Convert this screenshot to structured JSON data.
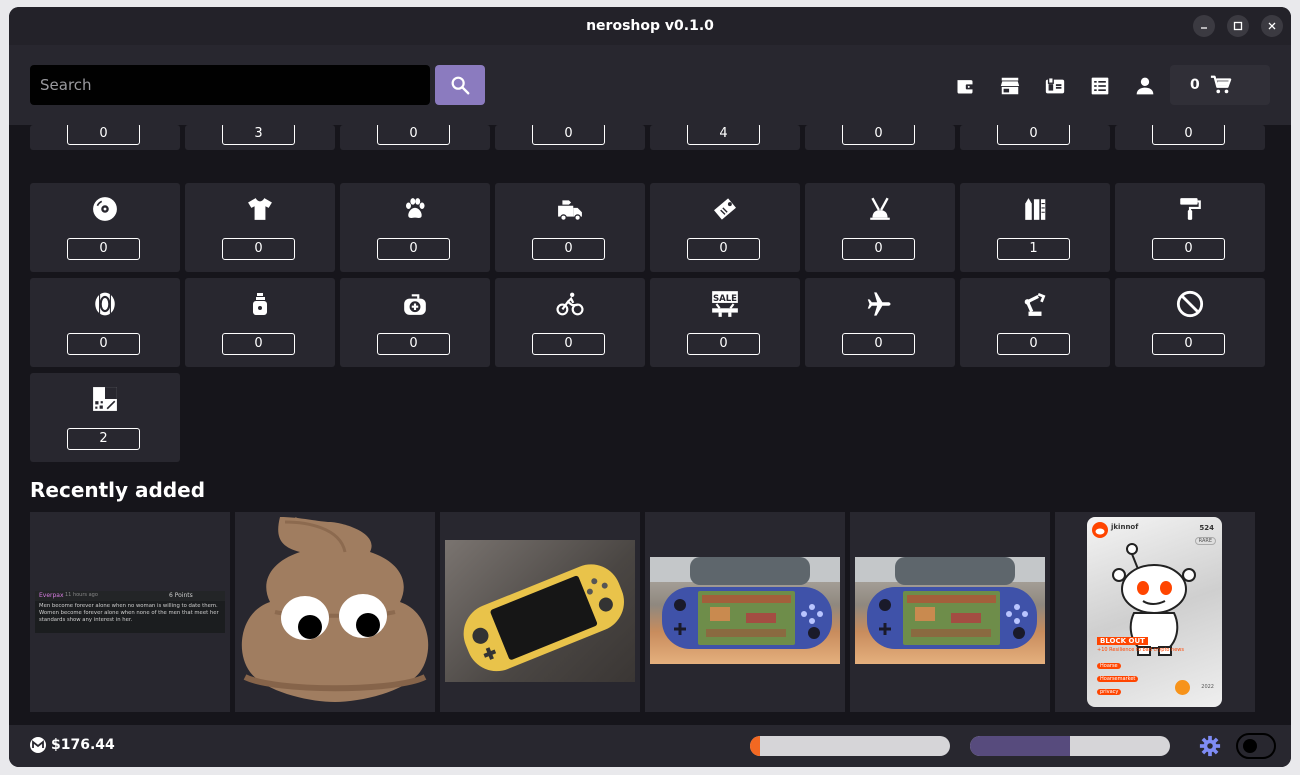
{
  "window": {
    "title": "neroshop v0.1.0",
    "minimize_icon": "minimize-icon",
    "maximize_icon": "maximize-icon",
    "close_icon": "close-icon"
  },
  "header": {
    "search": {
      "placeholder": "Search",
      "value": ""
    },
    "nav_icons": [
      "wallet-icon",
      "store-icon",
      "inventory-icon",
      "orders-icon",
      "account-icon"
    ],
    "cart": {
      "count": "0",
      "icon": "cart-icon"
    }
  },
  "categories": {
    "row0": [
      "0",
      "3",
      "0",
      "0",
      "4",
      "0",
      "0",
      "0"
    ],
    "row1": [
      {
        "icon": "disc-icon",
        "count": "0"
      },
      {
        "icon": "tshirt-icon",
        "count": "0"
      },
      {
        "icon": "paw-icon",
        "count": "0"
      },
      {
        "icon": "truck-icon",
        "count": "0"
      },
      {
        "icon": "tag-icon",
        "count": "0"
      },
      {
        "icon": "desk-lamp-icon",
        "count": "0"
      },
      {
        "icon": "books-icon",
        "count": "1"
      },
      {
        "icon": "paint-roller-icon",
        "count": "0"
      }
    ],
    "row2": [
      {
        "icon": "tire-icon",
        "count": "0"
      },
      {
        "icon": "medicine-bottle-icon",
        "count": "0"
      },
      {
        "icon": "first-aid-kit-icon",
        "count": "0"
      },
      {
        "icon": "bicycle-icon",
        "count": "0"
      },
      {
        "icon": "sale-sign-icon",
        "count": "0"
      },
      {
        "icon": "airplane-icon",
        "count": "0"
      },
      {
        "icon": "robot-arm-icon",
        "count": "0"
      },
      {
        "icon": "prohibited-icon",
        "count": "0"
      }
    ],
    "row3": [
      {
        "icon": "misc-pattern-icon",
        "count": "2"
      }
    ]
  },
  "recent": {
    "title": "Recently added",
    "items": [
      {
        "kind": "comment-screenshot",
        "user": "Everpax",
        "time": "11 hours ago",
        "points": "6 Points",
        "text": "Men become forever alone when no woman is willing to date them. Women become forever alone when none of the men that meet her standards show any interest in her."
      },
      {
        "kind": "poop-emoji"
      },
      {
        "kind": "yellow-switch-lite"
      },
      {
        "kind": "blue-switch-lite"
      },
      {
        "kind": "blue-switch-lite"
      },
      {
        "kind": "reddit-avatar-card",
        "username": "jkinnof",
        "number": "524",
        "rarity": "RARE",
        "headline": "BLOCK OUT",
        "subline": "+10 Resilience to bad crypto news",
        "tag1": "Hoarse",
        "tag2": "Hoarsemarket",
        "tag3": "privacy",
        "year": "2022"
      }
    ]
  },
  "footer": {
    "balance": "$176.44",
    "monero_icon": "monero-icon",
    "sync_progress": 0.05,
    "second_progress": 0.5,
    "colors": {
      "sync": "#f26822",
      "second": "#574b7d",
      "accent": "#8b7bbf",
      "gear": "#7f8cf5"
    },
    "settings_icon": "gear-icon",
    "toggle_icon": "dark-mode-toggle"
  }
}
